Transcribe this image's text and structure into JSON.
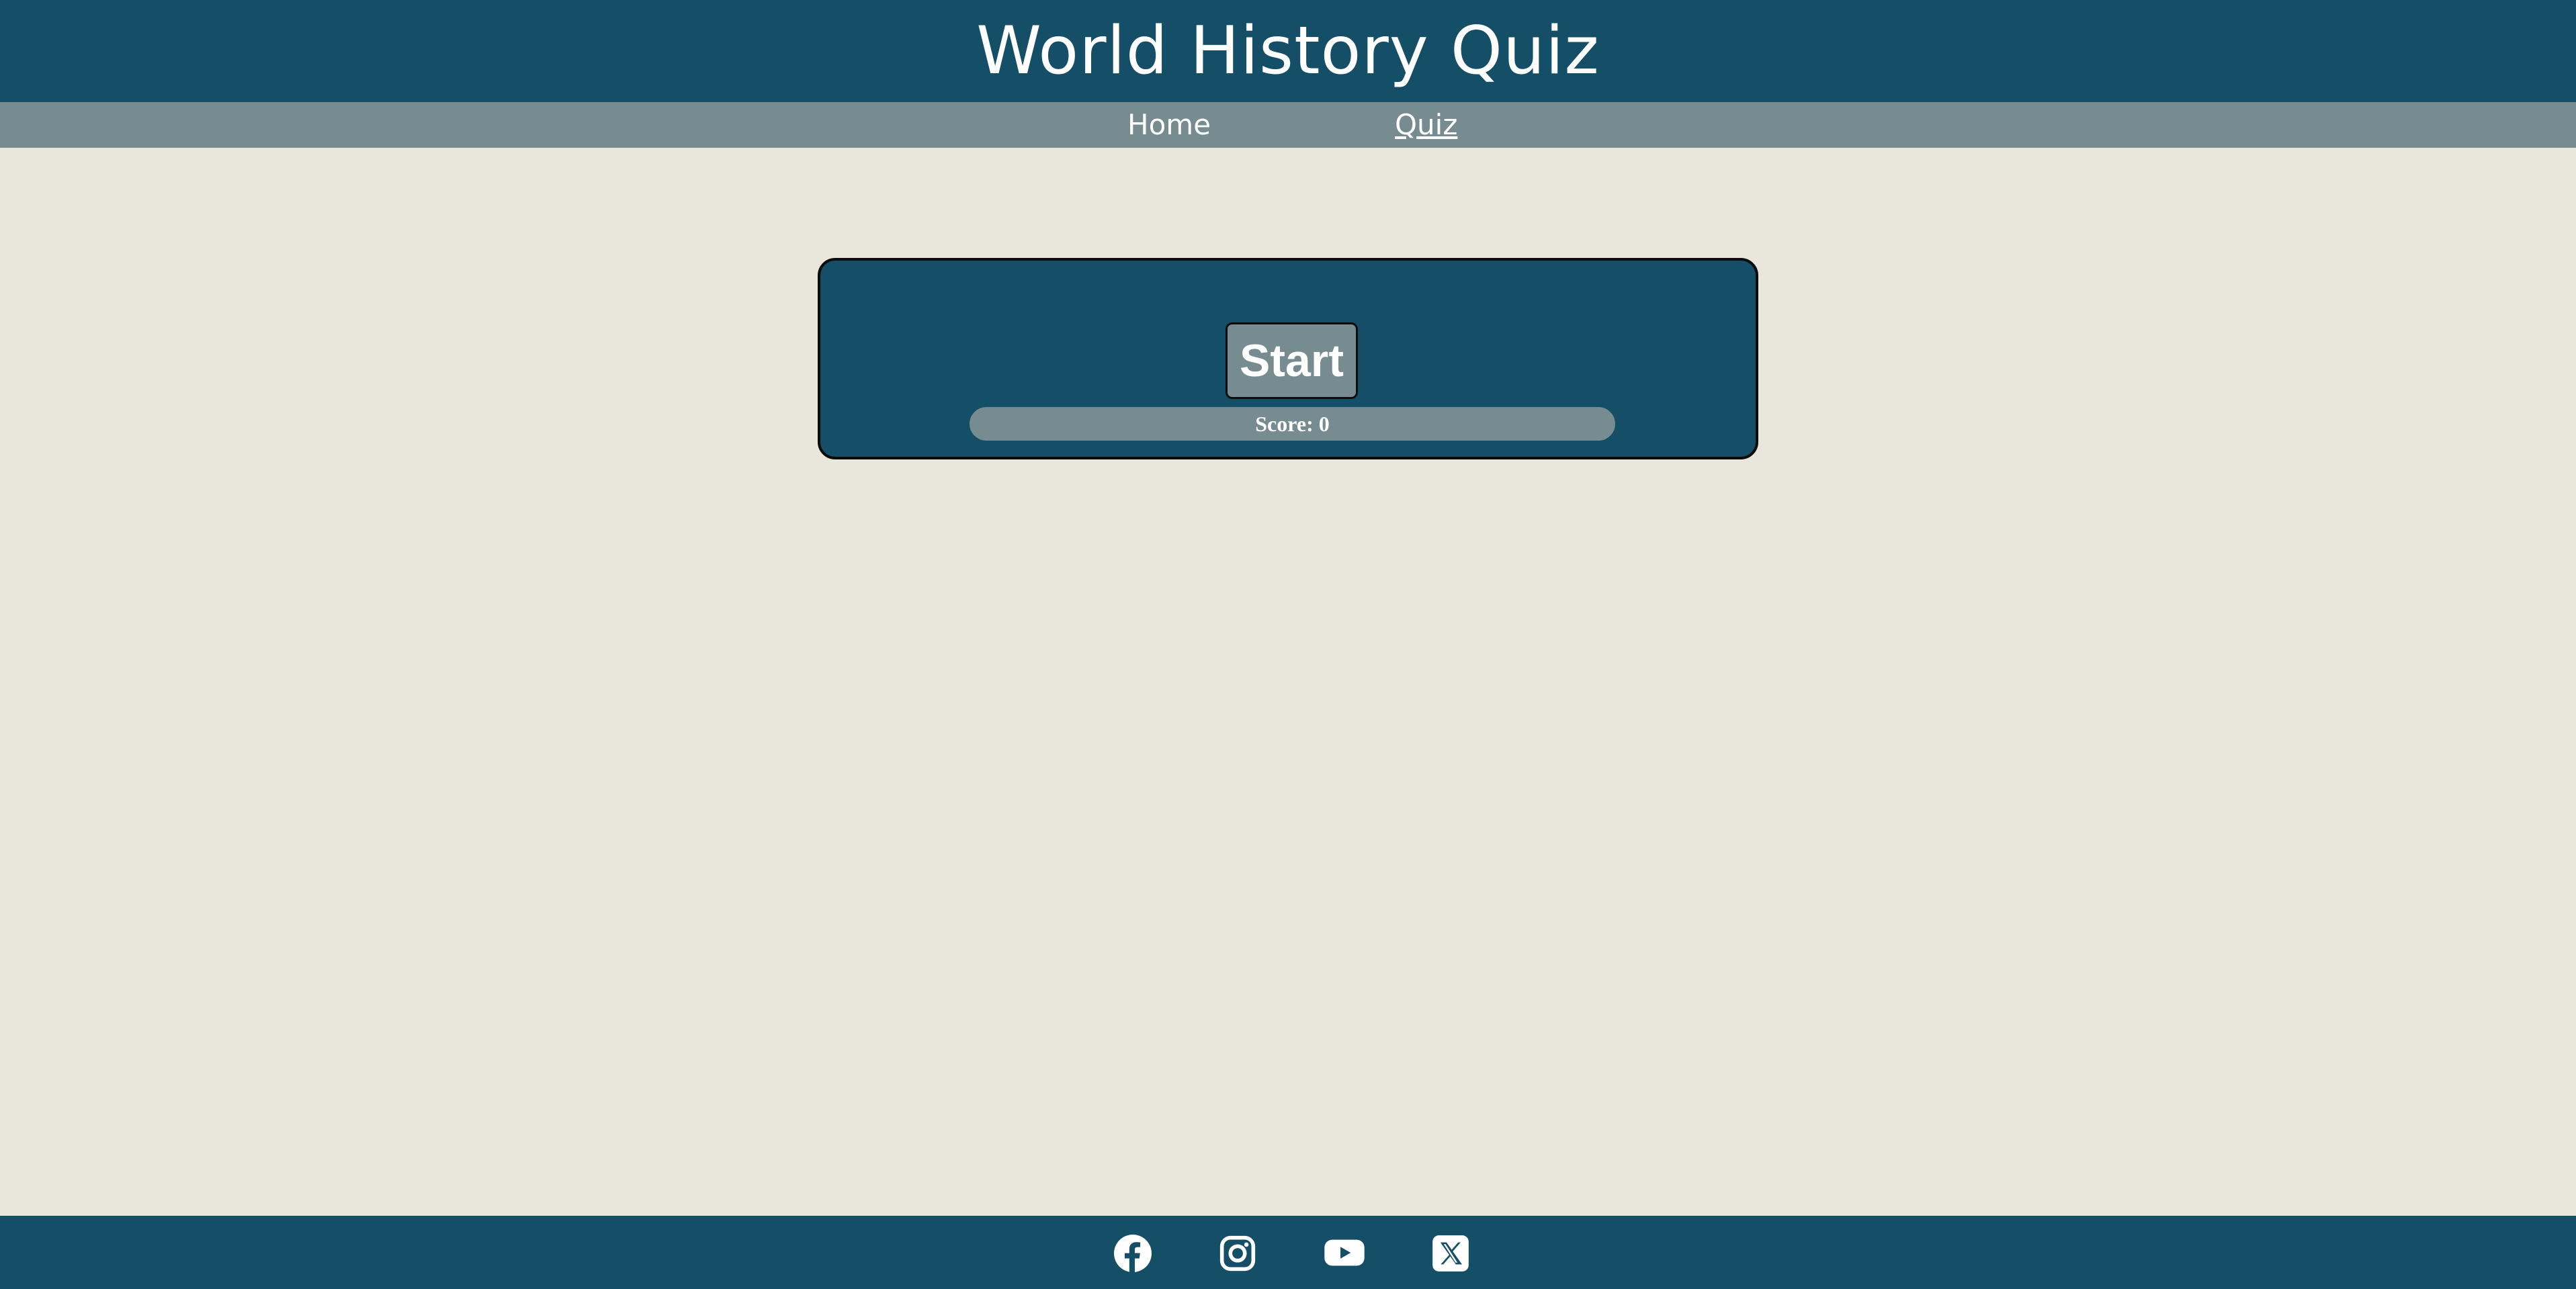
{
  "header": {
    "title": "World History Quiz"
  },
  "nav": {
    "items": [
      {
        "label": "Home"
      },
      {
        "label": "Quiz",
        "active": true
      }
    ]
  },
  "quiz": {
    "start_label": "Start",
    "score_label": "Score: 0"
  },
  "footer": {
    "social_icons": [
      "facebook-icon",
      "instagram-icon",
      "youtube-icon",
      "x-icon"
    ]
  },
  "colors": {
    "primary": "#144e67",
    "secondary": "#768c91",
    "background": "#e9e6db",
    "text": "#ffffff"
  }
}
